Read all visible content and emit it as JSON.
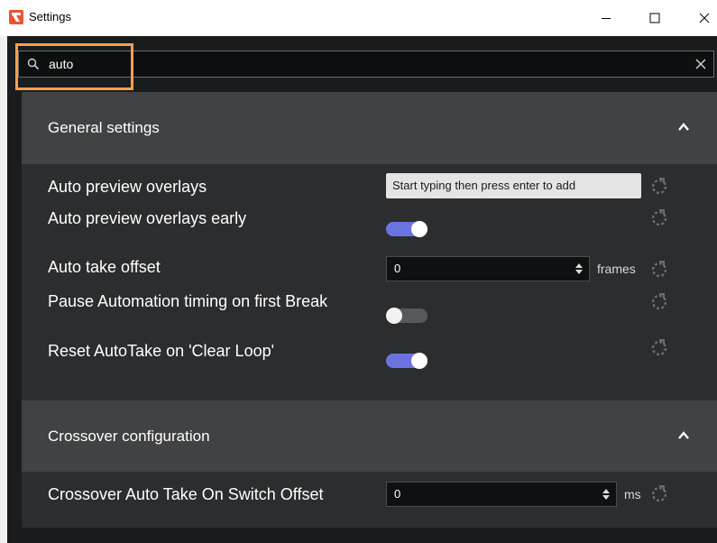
{
  "window": {
    "title": "Settings"
  },
  "search": {
    "value": "auto"
  },
  "general": {
    "title": "General settings",
    "rows": [
      {
        "label": "Auto preview overlays",
        "placeholder": "Start typing then press enter to add"
      },
      {
        "label": "Auto preview overlays early",
        "toggle": "on"
      },
      {
        "label": "Auto take offset",
        "value": "0",
        "unit": "frames"
      },
      {
        "label": "Pause Automation timing on first Break",
        "toggle": "off"
      },
      {
        "label": "Reset AutoTake on 'Clear Loop'",
        "toggle": "on"
      }
    ]
  },
  "crossover": {
    "title": "Crossover configuration",
    "rows": [
      {
        "label": "Crossover Auto Take On Switch Offset",
        "value": "0",
        "unit": "ms"
      }
    ]
  },
  "colors": {
    "accent": "#6b73e0",
    "highlight": "#f5a04d",
    "app_icon": "#e8542f"
  },
  "icons": [
    "app-logo-icon",
    "minimize-icon",
    "maximize-icon",
    "close-icon",
    "search-icon",
    "clear-icon",
    "chevron-up-icon",
    "reset-icon",
    "spinner-arrows-icon"
  ]
}
